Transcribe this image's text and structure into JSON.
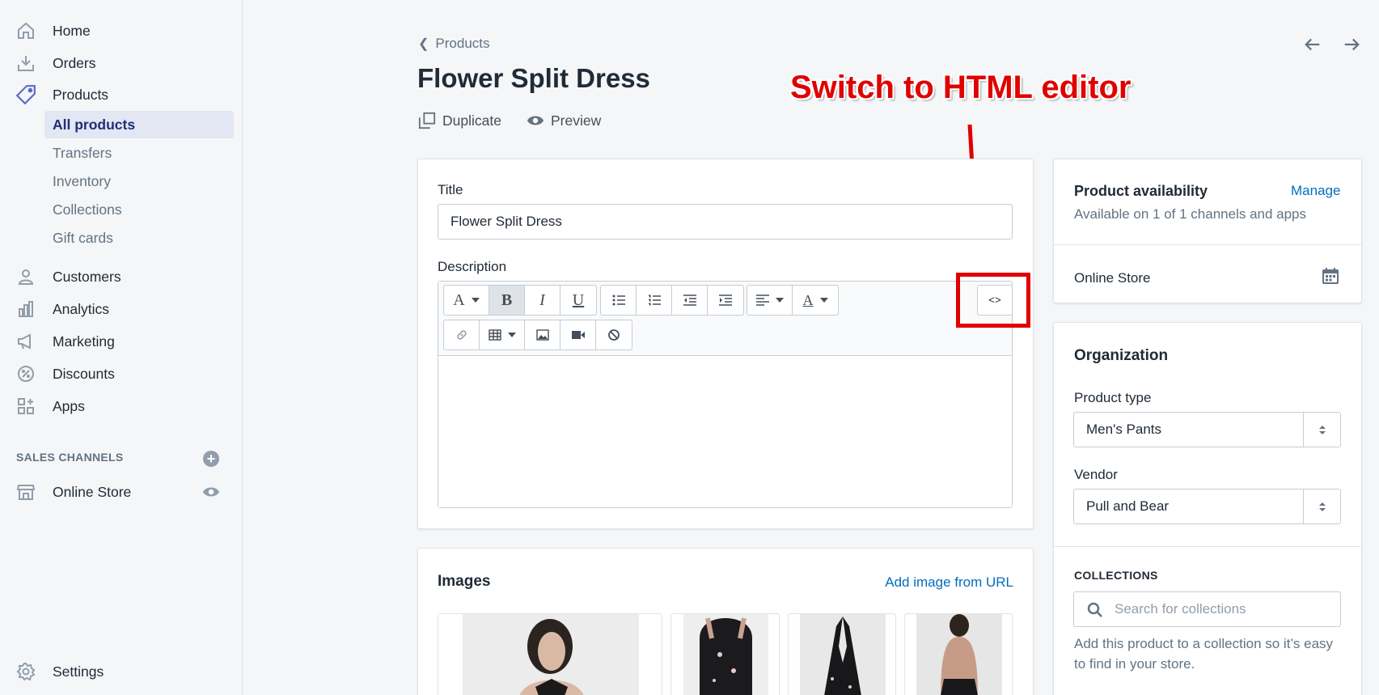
{
  "sidebar": {
    "items": [
      {
        "label": "Home",
        "icon": "home-icon"
      },
      {
        "label": "Orders",
        "icon": "orders-icon"
      },
      {
        "label": "Products",
        "icon": "tag-icon"
      },
      {
        "label": "Customers",
        "icon": "person-icon"
      },
      {
        "label": "Analytics",
        "icon": "bar-chart-icon"
      },
      {
        "label": "Marketing",
        "icon": "megaphone-icon"
      },
      {
        "label": "Discounts",
        "icon": "discount-icon"
      },
      {
        "label": "Apps",
        "icon": "apps-icon"
      }
    ],
    "product_subitems": [
      "All products",
      "Transfers",
      "Inventory",
      "Collections",
      "Gift cards"
    ],
    "sales_channels_title": "SALES CHANNELS",
    "online_store": "Online Store",
    "settings": "Settings"
  },
  "header": {
    "breadcrumb": "Products",
    "title": "Flower Split Dress",
    "duplicate": "Duplicate",
    "preview": "Preview"
  },
  "annotation": {
    "text": "Switch to HTML editor",
    "color": "#e00000"
  },
  "product_form": {
    "title_label": "Title",
    "title_value": "Flower Split Dress",
    "description_label": "Description",
    "html_toggle": "<>"
  },
  "images": {
    "heading": "Images",
    "add_link": "Add image from URL"
  },
  "availability": {
    "heading": "Product availability",
    "manage": "Manage",
    "subtitle": "Available on 1 of 1 channels and apps",
    "channel": "Online Store"
  },
  "organization": {
    "heading": "Organization",
    "product_type_label": "Product type",
    "product_type_value": "Men's Pants",
    "vendor_label": "Vendor",
    "vendor_value": "Pull and Bear",
    "collections_label": "COLLECTIONS",
    "collections_placeholder": "Search for collections",
    "collections_help": "Add this product to a collection so it’s easy to find in your store."
  },
  "colors": {
    "link": "#006fbb",
    "selected_nav_bg": "#e3e7f3",
    "selected_nav_text": "#202e78"
  }
}
